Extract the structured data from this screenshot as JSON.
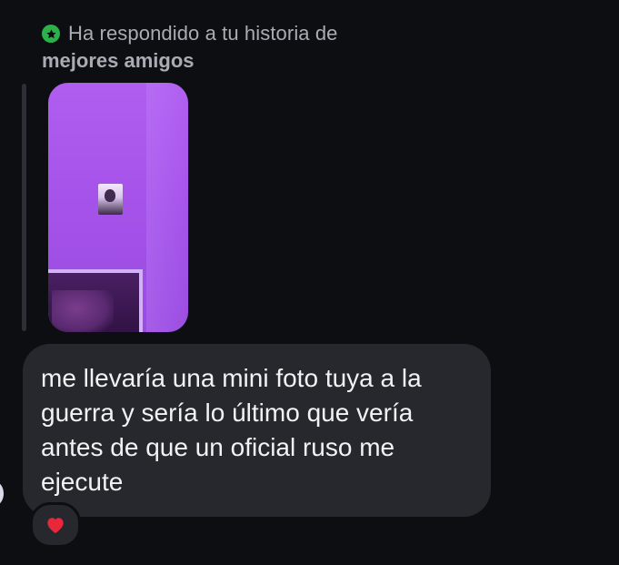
{
  "reply_header": {
    "icon": "star-circle-icon",
    "icon_color": "#2bb14a",
    "text": "Ha respondido a tu historia de",
    "highlight": "mejores amigos"
  },
  "story": {
    "type": "story-thumbnail",
    "tint": "#a653ea"
  },
  "message": {
    "text": "me llevaría una mini foto tuya a la\nguerra y sería lo último que vería\nantes de que un oficial ruso me\nejecute"
  },
  "reaction": {
    "emoji": "❤️",
    "icon": "heart-icon",
    "color": "#e8283a"
  }
}
